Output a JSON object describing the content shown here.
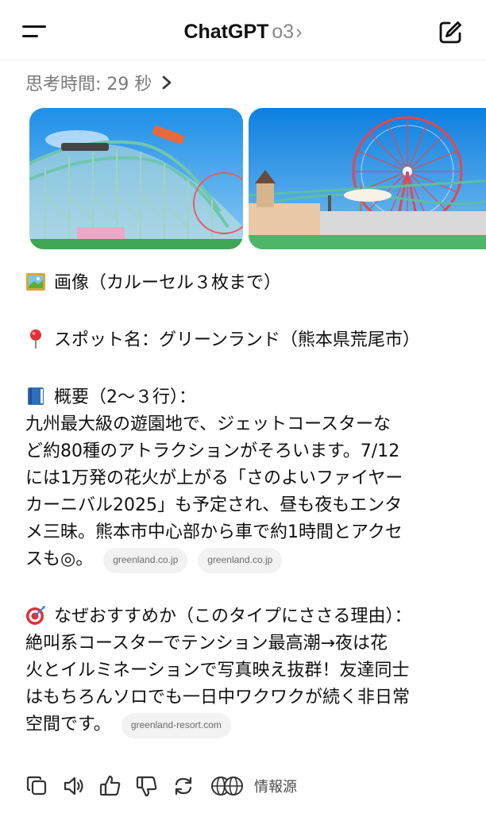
{
  "header": {
    "app_title": "ChatGPT",
    "model": "o3",
    "model_chevron": "›"
  },
  "thinking": {
    "label": "思考時間: 29 秒"
  },
  "carousel": {
    "images": [
      {
        "name": "roller-coaster-photo"
      },
      {
        "name": "ferris-wheel-park-photo"
      }
    ]
  },
  "message": {
    "images_line": "画像（カルーセル３枚まで）",
    "spot_line": "スポット名：グリーンランド（熊本県荒尾市）",
    "summary_heading": "概要（2〜３行）：",
    "summary_lines": [
      "九州最大級の遊園地で、ジェットコースターな",
      "ど約80種のアトラクションがそろいます。7/12",
      "には1万発の花火が上がる「さのよいファイヤー",
      "カーニバル2025」も予定され、昼も夜もエンタ",
      "メ三昧。熊本市中心部から車で約1時間とアクセ",
      "スも◎。"
    ],
    "summary_sources": [
      "greenland.co.jp",
      "greenland.co.jp"
    ],
    "why_heading": "なぜおすすめか（このタイプにささる理由）：",
    "why_lines": [
      "絶叫系コースターでテンション最高潮→夜は花",
      "火とイルミネーションで写真映え抜群！友達同士",
      "はもちろんソロでも一日中ワクワクが続く非日常",
      "空間です。"
    ],
    "why_source": "greenland-resort.com"
  },
  "actions": {
    "sources_label": "情報源"
  }
}
